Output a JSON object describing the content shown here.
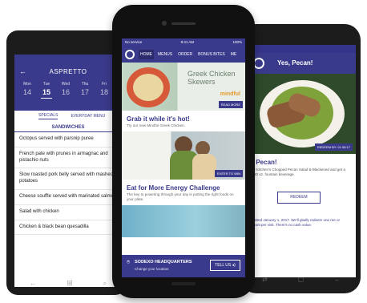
{
  "left_phone": {
    "header": {
      "title": "ASPRETTO"
    },
    "days": [
      {
        "name": "Mon",
        "date": "14"
      },
      {
        "name": "Tue",
        "date": "15",
        "selected": true
      },
      {
        "name": "Wed",
        "date": "16"
      },
      {
        "name": "Thu",
        "date": "17"
      },
      {
        "name": "Fri",
        "date": "18"
      }
    ],
    "tabs": {
      "specials": "SPECIALS",
      "everyday": "EVERYDAY MENU"
    },
    "section": "SANDWICHES",
    "items": [
      "Octopus served with parsnip puree",
      "French pate with prunes in armagnac and pistachio nuts",
      "Slow roasted pork belly served with mashed potatoes",
      "Cheese souffle served with marinated salmon",
      "Salad with chicken",
      "Chicken & black bean quesadilla"
    ]
  },
  "center_phone": {
    "status": {
      "carrier": "No service",
      "time": "9:41 AM",
      "battery": "100%"
    },
    "nav": [
      "HOME",
      "MENUS",
      "ORDER",
      "BONUS BITES",
      "ME"
    ],
    "card1": {
      "image_title": "Greek Chicken Skewers",
      "image_brand": "mindful",
      "more": "READ MORE",
      "heading": "Grab it while it's hot!",
      "text": "Try our new Mindful Greek Chicken."
    },
    "card2": {
      "more": "ENTER TO WIN",
      "heading": "Eat for More Energy Challenge",
      "text": "The key to powering through your day is putting the right foods on your plate."
    },
    "bottom": {
      "location": "SODEXO HEADQUARTERS",
      "change": "Change your location",
      "tell_us": "TELL US"
    }
  },
  "right_phone": {
    "header": {
      "title": "Yes, Pecan!"
    },
    "badge": "REDEEM BY: 01.08.17",
    "heading": "es, Pecan!",
    "text": "in My Kitchen's Chopped Pecan Salad & Blackened and get a free 20 oz. fountain beverage.",
    "redeem": "REDEEM",
    "fine_print": "d on Wed January 1, 2017. We'll gladly redeem one ree or discount per visit. There's no cash value."
  }
}
